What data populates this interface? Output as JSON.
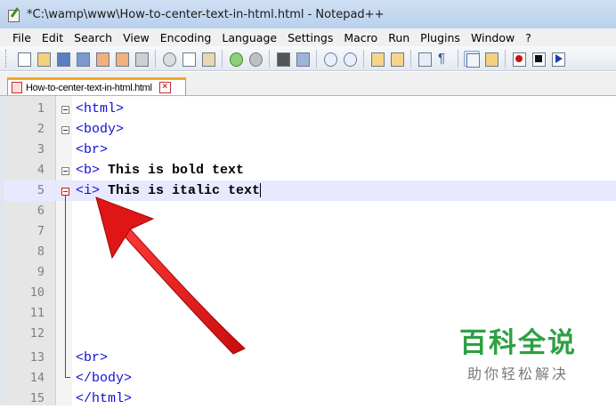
{
  "window": {
    "title": "*C:\\wamp\\www\\How-to-center-text-in-html.html - Notepad++"
  },
  "menu": [
    "File",
    "Edit",
    "Search",
    "View",
    "Encoding",
    "Language",
    "Settings",
    "Macro",
    "Run",
    "Plugins",
    "Window",
    "?"
  ],
  "toolbar": {
    "buttons": [
      "new-file-icon",
      "open-file-icon",
      "save-icon",
      "save-all-icon",
      "close-icon",
      "close-all-icon",
      "print-icon",
      "cut-icon",
      "copy-icon",
      "paste-icon",
      "undo-icon",
      "redo-icon",
      "find-icon",
      "replace-icon",
      "zoom-in-icon",
      "zoom-out-icon",
      "sync-vertical-icon",
      "sync-horizontal-icon",
      "word-wrap-icon",
      "show-all-chars-icon",
      "indent-guide-icon",
      "user-lang-icon",
      "record-macro-icon",
      "stop-record-icon",
      "play-macro-icon"
    ]
  },
  "tabs": [
    {
      "label": "How-to-center-text-in-html.html",
      "modified": true
    }
  ],
  "editor": {
    "current_line": 5,
    "lines": [
      {
        "n": "1",
        "tag": "<html>",
        "text": ""
      },
      {
        "n": "2",
        "tag": "<body>",
        "text": ""
      },
      {
        "n": "3",
        "tag": "<br>",
        "text": ""
      },
      {
        "n": "4",
        "tag": "<b>",
        "text": " This is bold text"
      },
      {
        "n": "5",
        "tag": "<i>",
        "text": " This is italic text"
      },
      {
        "n": "6",
        "tag": "",
        "text": ""
      },
      {
        "n": "7",
        "tag": "",
        "text": ""
      },
      {
        "n": "8",
        "tag": "",
        "text": ""
      },
      {
        "n": "9",
        "tag": "",
        "text": ""
      },
      {
        "n": "10",
        "tag": "",
        "text": ""
      },
      {
        "n": "11",
        "tag": "",
        "text": ""
      },
      {
        "n": "12",
        "tag": "",
        "text": ""
      },
      {
        "n": "13",
        "tag": "<br>",
        "text": ""
      },
      {
        "n": "14",
        "tag": "</body>",
        "text": ""
      },
      {
        "n": "15",
        "tag": "</html>",
        "text": ""
      }
    ]
  },
  "watermark": {
    "main": "百科全说",
    "sub": "助你轻松解决"
  },
  "colors": {
    "tag": "#1010d0",
    "fold_marker": "#e01010",
    "arrow": "#e01515",
    "watermark": "#2ea043",
    "tab_accent": "#f5a623",
    "current_line": "#e8e8ff"
  }
}
